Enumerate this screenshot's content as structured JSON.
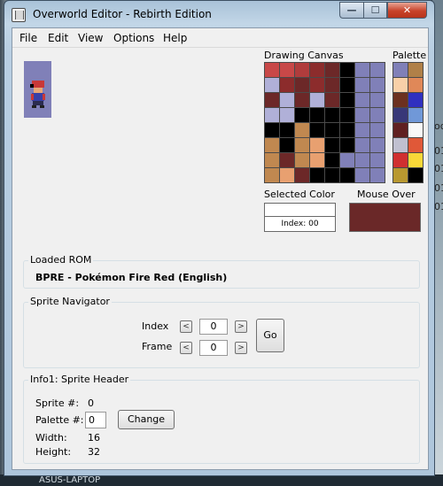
{
  "window": {
    "title": "Overworld Editor - Rebirth Edition"
  },
  "menu": [
    "File",
    "Edit",
    "View",
    "Options",
    "Help"
  ],
  "labels": {
    "drawing_canvas": "Drawing Canvas",
    "palette": "Palette",
    "selected_color": "Selected Color",
    "mouse_over": "Mouse Over"
  },
  "canvas_colors": [
    [
      "#c84848",
      "#c84848",
      "#b03c3c",
      "#8c2c2c",
      "#6c2828",
      "#000000",
      "#8080b8",
      "#8080b8"
    ],
    [
      "#b0b0d8",
      "#8c2c2c",
      "#6c2828",
      "#8c2c2c",
      "#6c2828",
      "#000000",
      "#8080b8",
      "#8080b8"
    ],
    [
      "#6c2828",
      "#b0b0d8",
      "#6c2828",
      "#b0b0d8",
      "#6c2828",
      "#000000",
      "#8080b8",
      "#8080b8"
    ],
    [
      "#b0b0d8",
      "#b0b0d8",
      "#000000",
      "#000000",
      "#000000",
      "#000000",
      "#8080b8",
      "#8080b8"
    ],
    [
      "#000000",
      "#000000",
      "#c08850",
      "#000000",
      "#000000",
      "#000000",
      "#8080b8",
      "#8080b8"
    ],
    [
      "#c08850",
      "#000000",
      "#c08850",
      "#e8a070",
      "#000000",
      "#000000",
      "#8080b8",
      "#8080b8"
    ],
    [
      "#c08850",
      "#6c2828",
      "#c08850",
      "#e8a070",
      "#000000",
      "#8080b8",
      "#8080b8",
      "#8080b8"
    ],
    [
      "#c08850",
      "#e8a070",
      "#6c2828",
      "#000000",
      "#000000",
      "#000000",
      "#8080b8",
      "#8080b8"
    ]
  ],
  "palette_colors": [
    [
      "#8080b8",
      "#b08048"
    ],
    [
      "#f8d0a8",
      "#e08858"
    ],
    [
      "#6c3020",
      "#3030c0"
    ],
    [
      "#383878",
      "#7098d8"
    ],
    [
      "#602020",
      "#f8f8f8"
    ],
    [
      "#c0c0d0",
      "#e05838"
    ],
    [
      "#d03030",
      "#f8d838"
    ],
    [
      "#b89830",
      "#000000"
    ]
  ],
  "selected_color": {
    "color": "#ffffff",
    "index_text": "Index: 00"
  },
  "mouse_over": {
    "color": "#6a2828"
  },
  "loaded_rom": {
    "title": "Loaded ROM",
    "name": "BPRE - Pokémon Fire Red (English)"
  },
  "sprite_navigator": {
    "title": "Sprite Navigator",
    "index_label": "Index",
    "index_value": "0",
    "frame_label": "Frame",
    "frame_value": "0",
    "go_label": "Go",
    "left_arrow": "<",
    "right_arrow": ">"
  },
  "sprite_header": {
    "title": "Info1: Sprite Header",
    "sprite_label": "Sprite #:",
    "sprite_value": "0",
    "palette_label": "Palette #:",
    "palette_value": "0",
    "change_label": "Change",
    "width_label": "Width:",
    "width_value": "16",
    "height_label": "Height:",
    "height_value": "32"
  },
  "background": {
    "right_fragments": [
      "od",
      "01",
      "01",
      "01",
      "01"
    ],
    "taskbar_label": "ASUS-LAPTOP"
  }
}
